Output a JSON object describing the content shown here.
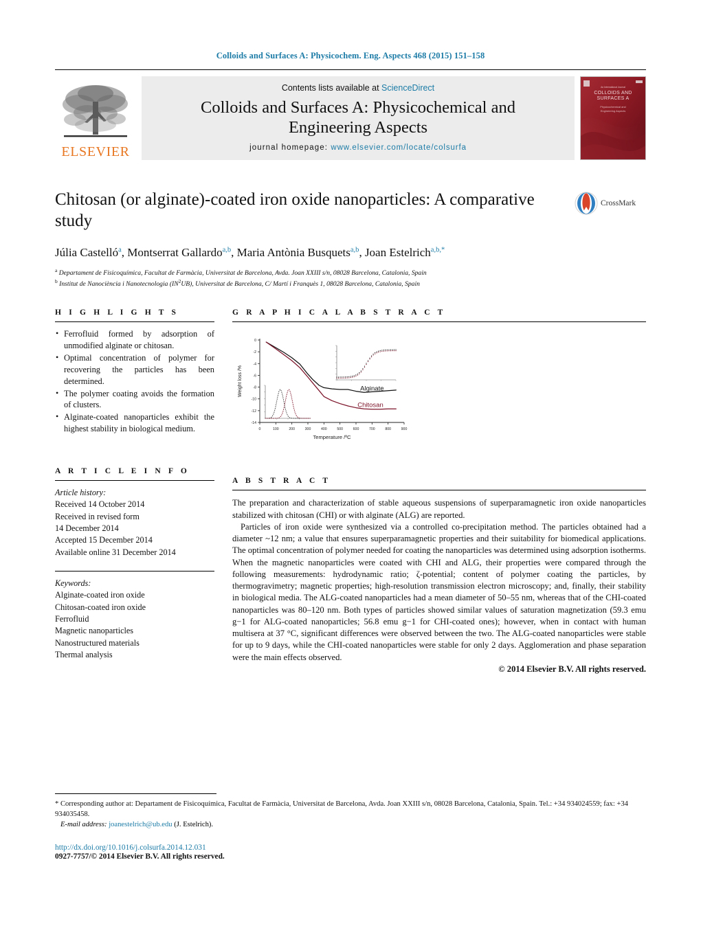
{
  "running_head": "Colloids and Surfaces A: Physicochem. Eng. Aspects 468 (2015) 151–158",
  "masthead": {
    "contents_prefix": "Contents lists available at ",
    "sciencedirect": "ScienceDirect",
    "journal_title_line1": "Colloids and Surfaces A: Physicochemical and",
    "journal_title_line2": "Engineering Aspects",
    "homepage_label": "journal homepage:",
    "homepage_url": "www.elsevier.com/locate/colsurfa",
    "publisher": "ELSEVIER",
    "cover_line1": "An Internationl Journal",
    "cover_line2": "COLLOIDS AND",
    "cover_line3": "SURFACES A",
    "cover_line4": "Physicochemical and",
    "cover_line5": "Engineering Aspects"
  },
  "article": {
    "title": "Chitosan (or alginate)-coated iron oxide nanoparticles: A comparative study",
    "crossmark_label": "CrossMark",
    "authors_html": "Júlia Castelló<sup>a</sup>, Montserrat Gallardo<sup>a,b</sup>, Maria Antònia Busquets<sup>a,b</sup>, Joan Estelrich<sup>a,b,</sup><sup>*</sup>",
    "affiliations": [
      "<sup>a</sup> Departament de Fisicoquímica, Facultat de Farmàcia, Universitat de Barcelona, Avda. Joan XXIII s/n, 08028 Barcelona, Catalonia, Spain",
      "<sup>b</sup> Institut de Nanociència i Nanotecnologia (IN<sup>2</sup>UB), Universitat de Barcelona, C/ Martí i Franquès 1, 08028 Barcelona, Catalonia, Spain"
    ]
  },
  "highlights": {
    "heading": "H I G H L I G H T S",
    "items": [
      "Ferrofluid formed by adsorption of unmodified alginate or chitosan.",
      "Optimal concentration of polymer for recovering the particles has been determined.",
      "The polymer coating avoids the formation of clusters.",
      "Alginate-coated nanoparticles exhibit the highest stability in biological medium."
    ]
  },
  "graphical_abstract": {
    "heading": "G R A P H I C A L   A B S T R A C T"
  },
  "article_info": {
    "heading": "A R T I C L E   I N F O",
    "history_label": "Article history:",
    "history": [
      "Received 14 October 2014",
      "Received in revised form",
      "14 December 2014",
      "Accepted 15 December 2014",
      "Available online 31 December 2014"
    ],
    "keywords_label": "Keywords:",
    "keywords": [
      "Alginate-coated iron oxide",
      "Chitosan-coated iron oxide",
      "Ferrofluid",
      "Magnetic nanoparticles",
      "Nanostructured materials",
      "Thermal analysis"
    ]
  },
  "abstract": {
    "heading": "A B S T R A C T",
    "paragraph1": "The preparation and characterization of stable aqueous suspensions of superparamagnetic iron oxide nanoparticles stabilized with chitosan (CHI) or with alginate (ALG) are reported.",
    "paragraph2": "Particles of iron oxide were synthesized via a controlled co-precipitation method. The particles obtained had a diameter ~12 nm; a value that ensures superparamagnetic properties and their suitability for biomedical applications. The optimal concentration of polymer needed for coating the nanoparticles was determined using adsorption isotherms. When the magnetic nanoparticles were coated with CHI and ALG, their properties were compared through the following measurements: hydrodynamic ratio; ζ-potential; content of polymer coating the particles, by thermogravimetry; magnetic properties; high-resolution transmission electron microscopy; and, finally, their stability in biological media. The ALG-coated nanoparticles had a mean diameter of 50–55 nm, whereas that of the CHI-coated nanoparticles was 80–120 nm. Both types of particles showed similar values of saturation magnetization (59.3 emu g−1 for ALG-coated nanoparticles; 56.8 emu g−1 for CHI-coated ones); however, when in contact with human multisera at 37 °C, significant differences were observed between the two. The ALG-coated nanoparticles were stable for up to 9 days, while the CHI-coated nanoparticles were stable for only 2 days. Agglomeration and phase separation were the main effects observed.",
    "copyright": "© 2014 Elsevier B.V. All rights reserved."
  },
  "footer": {
    "corresponding": "* Corresponding author at: Departament de Fisicoquímica, Facultat de Farmàcia, Universitat de Barcelona, Avda. Joan XXIII s/n, 08028 Barcelona, Catalonia, Spain. Tel.: +34 934024559; fax: +34 934035458.",
    "email_label": "E-mail address:",
    "email": "joanestelrich@ub.edu",
    "email_owner": "(J. Estelrich).",
    "doi": "http://dx.doi.org/10.1016/j.colsurfa.2014.12.031",
    "issn": "0927-7757/© 2014 Elsevier B.V. All rights reserved."
  },
  "colors": {
    "link": "#1b7ba6",
    "elsevier_orange": "#e87722",
    "alginate": "#111111",
    "chitosan": "#7b1228"
  },
  "chart_data": {
    "type": "line",
    "title": "",
    "xlabel": "Temperature /ºC",
    "ylabel": "Weight loss /%",
    "xlim": [
      0,
      900
    ],
    "ylim": [
      -14,
      0
    ],
    "xticks": [
      0,
      100,
      200,
      300,
      400,
      500,
      600,
      700,
      800,
      900
    ],
    "yticks": [
      0,
      -2,
      -4,
      -6,
      -8,
      -10,
      -12,
      -14
    ],
    "grid": false,
    "legend": "inline-annotations",
    "annotations": [
      {
        "text": "Alginate",
        "x": 700,
        "y": -8.6,
        "color": "#111111"
      },
      {
        "text": "Chitosan",
        "x": 690,
        "y": -11.4,
        "color": "#7b1228"
      }
    ],
    "series": [
      {
        "name": "Alginate",
        "color": "#111111",
        "x": [
          40,
          100,
          150,
          200,
          250,
          300,
          330,
          370,
          400,
          450,
          500,
          550,
          600,
          650,
          700,
          750,
          800,
          850
        ],
        "y": [
          -0.35,
          -1.3,
          -2.1,
          -3.0,
          -4.1,
          -5.8,
          -6.7,
          -7.7,
          -8.1,
          -8.3,
          -8.4,
          -8.4,
          -8.7,
          -8.9,
          -8.8,
          -8.7,
          -8.6,
          -8.5
        ]
      },
      {
        "name": "Chitosan",
        "color": "#7b1228",
        "x": [
          40,
          100,
          150,
          200,
          250,
          300,
          330,
          370,
          400,
          450,
          500,
          550,
          600,
          650,
          700,
          750,
          800,
          850
        ],
        "y": [
          -0.35,
          -1.5,
          -2.5,
          -3.5,
          -4.7,
          -6.3,
          -7.3,
          -8.6,
          -9.6,
          -10.3,
          -10.8,
          -11.2,
          -11.5,
          -11.7,
          -11.75,
          -11.75,
          -11.7,
          -11.7
        ]
      }
    ],
    "inset_left": {
      "type": "line",
      "description": "derivative DTG peaks",
      "series": [
        {
          "name": "Alginate DTG",
          "color": "#333333",
          "peak_x": 205
        },
        {
          "name": "Chitosan DTG",
          "color": "#7b1228",
          "peak_x": 265
        }
      ]
    },
    "inset_right": {
      "type": "scatter",
      "description": "magnetization hysteresis curve",
      "series": [
        {
          "name": "ALG",
          "color": "#111111"
        },
        {
          "name": "CHI",
          "color": "#7b1228"
        }
      ]
    }
  }
}
